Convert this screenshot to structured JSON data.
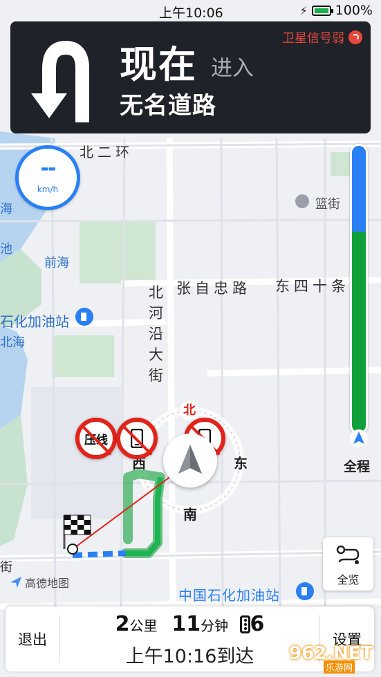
{
  "status_bar": {
    "time": "上午10:06",
    "battery": "100%",
    "battery_level": 1.0
  },
  "guidance": {
    "now": "现在",
    "action": "进入",
    "road": "无名道路",
    "gps_status": "卫星信号弱",
    "maneuver_icon": "u-turn-icon"
  },
  "speed": {
    "value": "--",
    "unit": "km/h"
  },
  "route_progress": {
    "completed_fraction": 0.3,
    "label": "全程"
  },
  "overview_button": {
    "label": "全览"
  },
  "logo": {
    "text": "高德地图"
  },
  "map": {
    "road_labels": [
      "北二环",
      "张自忠路",
      "东四十条",
      "北河沿大街",
      "中国石化加油站"
    ],
    "poi_labels": [
      "篮街",
      "前海",
      "石化加油站",
      "北海",
      "池",
      "海",
      "街"
    ],
    "restriction_signs": [
      "压线",
      "phone-icon",
      "phone-icon"
    ],
    "compass": {
      "north": "北",
      "west": "西",
      "east": "东",
      "south": "南"
    }
  },
  "bottom_bar": {
    "exit": "退出",
    "settings": "设置",
    "distance_value": "2",
    "distance_unit": "公里",
    "time_value": "11",
    "time_unit": "分钟",
    "traffic_lights": "6",
    "eta": "上午10:16到达"
  },
  "watermark": {
    "text": "962.NET",
    "sub": "乐游网"
  },
  "colors": {
    "accent": "#2a7ff5",
    "route_green": "#10a03a",
    "alert_red": "#e2231a",
    "panel_dark": "#1f2229"
  }
}
